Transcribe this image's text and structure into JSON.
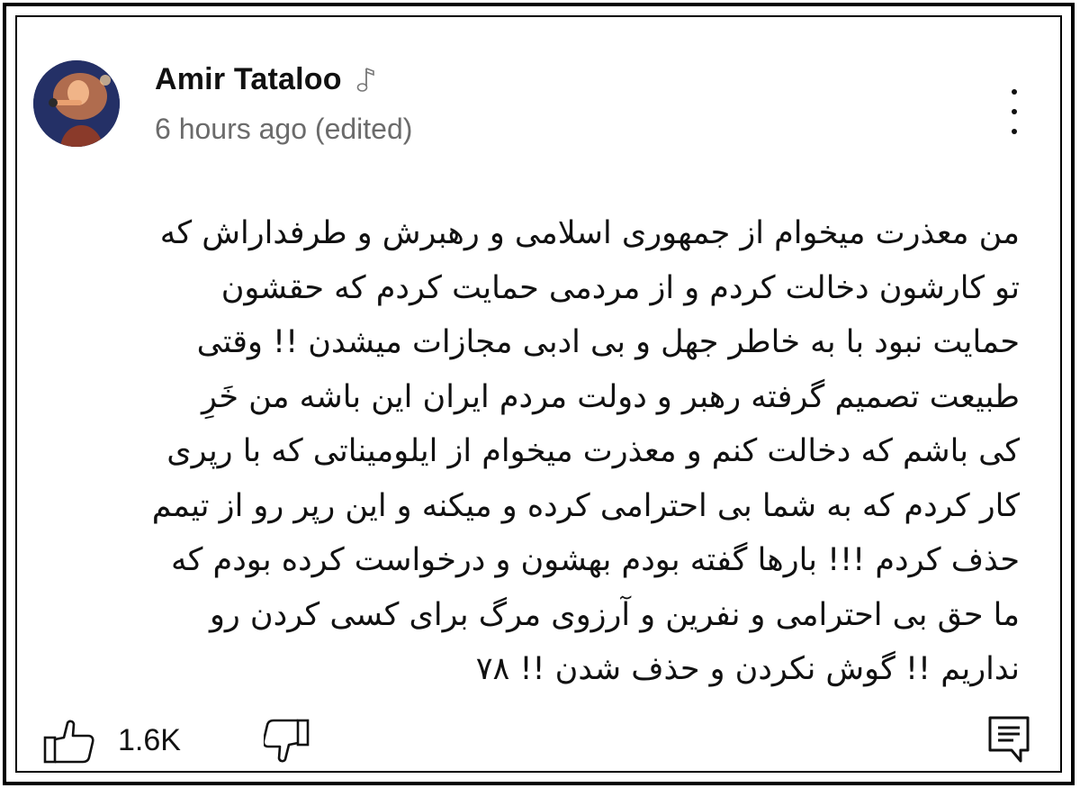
{
  "comment": {
    "author": "Amir Tataloo",
    "author_badge_icon": "music-note-icon",
    "timestamp": "6 hours ago (edited)",
    "lines": [
      "من معذرت میخوام از جمهوری اسلامی و رهبرش و طرفداراش که",
      "تو کارشون دخالت کردم و از مردمی حمایت کردم که حقشون",
      "حمایت نبود با به خاطر جهل و بی ادبی مجازات میشدن !! وقتی",
      "طبیعت تصمیم گرفته رهبر و دولت مردم ایران این باشه من خَرِ",
      "کی باشم که دخالت کنم و معذرت میخوام از ایلومیناتی که با رپری",
      "کار کردم که به شما بی احترامی کرده و میکنه و این رپر رو از تیمم",
      "حذف کردم !!! بارها گفته بودم بهشون و درخواست کرده بودم که",
      "ما حق بی احترامی و نفرین و آرزوی مرگ برای کسی کردن رو",
      "نداریم !! گوش نکردن و حذف شدن !! ۷۸"
    ]
  },
  "actions": {
    "like_count": "1.6K",
    "like_icon": "thumbs-up-icon",
    "dislike_icon": "thumbs-down-icon",
    "reply_icon": "reply-comment-icon",
    "more_icon": "more-vertical-icon"
  },
  "colors": {
    "text": "#111111",
    "secondary_text": "#6b6b6b",
    "border": "#000000",
    "background": "#ffffff"
  }
}
